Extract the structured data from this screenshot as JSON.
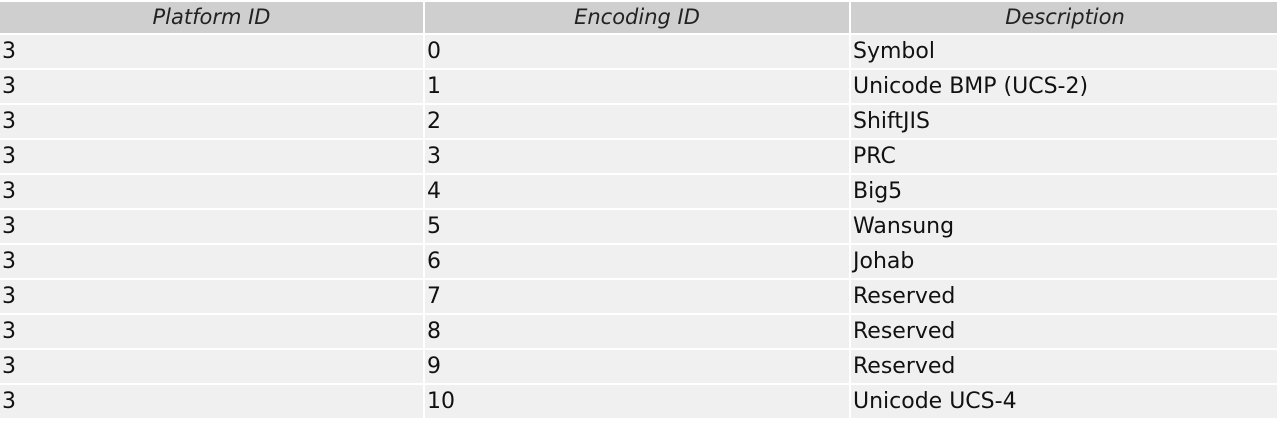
{
  "table": {
    "headers": [
      "Platform ID",
      "Encoding ID",
      "Description"
    ],
    "rows": [
      [
        "3",
        "0",
        "Symbol"
      ],
      [
        "3",
        "1",
        "Unicode BMP (UCS-2)"
      ],
      [
        "3",
        "2",
        "ShiftJIS"
      ],
      [
        "3",
        "3",
        "PRC"
      ],
      [
        "3",
        "4",
        "Big5"
      ],
      [
        "3",
        "5",
        "Wansung"
      ],
      [
        "3",
        "6",
        "Johab"
      ],
      [
        "3",
        "7",
        "Reserved"
      ],
      [
        "3",
        "8",
        "Reserved"
      ],
      [
        "3",
        "9",
        "Reserved"
      ],
      [
        "3",
        "10",
        "Unicode UCS-4"
      ]
    ]
  }
}
